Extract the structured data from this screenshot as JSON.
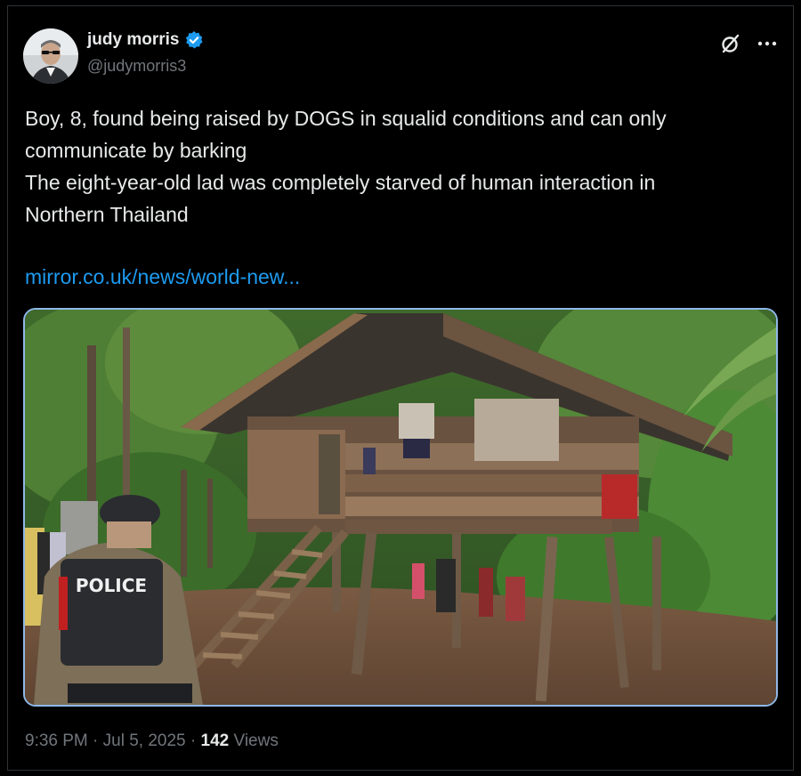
{
  "author": {
    "name": "judy morris",
    "handle": "@judymorris3"
  },
  "tweet": {
    "line1": "Boy, 8, found being raised by DOGS in squalid conditions and can only",
    "line2": "communicate by barking",
    "line3": "The eight-year-old lad was completely starved of human interaction in",
    "line4": "Northern Thailand",
    "link": "mirror.co.uk/news/world-new..."
  },
  "media": {
    "police_label": "POLICE"
  },
  "meta": {
    "time": "9:36 PM",
    "sep1": " · ",
    "date": "Jul 5, 2025",
    "sep2": " · ",
    "views_count": "142",
    "views_label": " Views"
  },
  "colors": {
    "background": "#000000",
    "text": "#e7e9ea",
    "muted": "#71767b",
    "link": "#1d9bf0",
    "verified": "#1d9bf0"
  },
  "icons": [
    "verified-badge-icon",
    "grok-icon",
    "more-options-icon"
  ]
}
